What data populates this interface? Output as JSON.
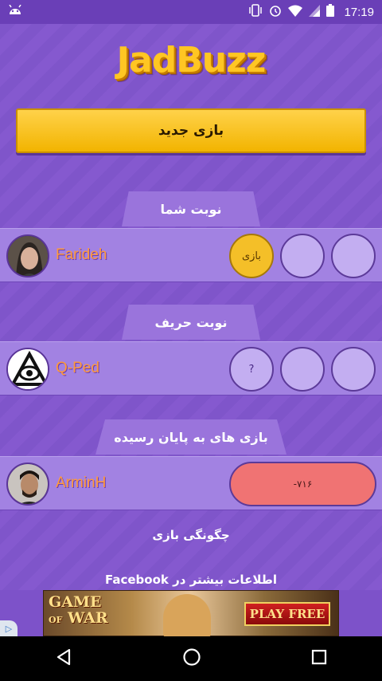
{
  "status_bar": {
    "time": "17:19",
    "icons": [
      "android-icon",
      "vibrate-icon",
      "alarm-icon",
      "wifi-icon",
      "signal-icon",
      "battery-icon"
    ]
  },
  "app": {
    "logo_text": "JadBuzz",
    "new_game_label": "بازی جدید"
  },
  "sections": {
    "your_turn": "نوبت شما",
    "opponent_turn": "نوبت حریف",
    "finished": "بازی های به پایان رسیده"
  },
  "games": {
    "your_turn": {
      "player": "Farideh",
      "rounds": [
        "بازی",
        "",
        ""
      ]
    },
    "opponent_turn": {
      "player": "Q-Ped",
      "rounds": [
        "?",
        "",
        ""
      ]
    },
    "finished": {
      "player": "ArminH",
      "score": "-۷۱۶"
    }
  },
  "links": {
    "how_to_play": "چگونگی بازی",
    "more_info": "اطلاعات بیشتر در Facebook"
  },
  "ad": {
    "title_line1": "GAME",
    "title_of": "OF",
    "title_line2": "WAR",
    "cta": "PLAY FREE",
    "choice_icon": "ad-choices-icon"
  },
  "colors": {
    "background": "#7d52c9",
    "accent_yellow": "#f4bf28",
    "row_bg": "#a282e2",
    "loss_red": "#f07373",
    "player_name": "#ff9a3a"
  }
}
